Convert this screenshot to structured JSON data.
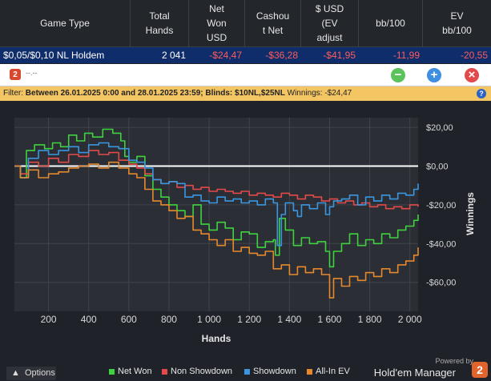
{
  "columns": [
    {
      "label": "Game Type"
    },
    {
      "label": "Total\nHands"
    },
    {
      "label": "Net\nWon\nUSD"
    },
    {
      "label": "Cashou\nt Net"
    },
    {
      "label": "$ USD\n(EV\nadjust"
    },
    {
      "label": "bb/100"
    },
    {
      "label": "EV\nbb/100"
    }
  ],
  "row": {
    "game_type": "$0,05/$0,10 NL Holdem",
    "total_hands": "2 041",
    "net_won": "-$24,47",
    "cashout_net": "-$36,28",
    "ev_adjusted": "-$41,95",
    "bb100": "-11,99",
    "ev_bb100": "-20,55"
  },
  "toolbar": {
    "logo_text": "2",
    "title": "--.--",
    "add_icon": "+",
    "remove_icon": "−",
    "close_icon": "×"
  },
  "filter": {
    "label": "Filter:",
    "text": "Between 26.01.2025 0:00 and 28.01.2025 23:59; Blinds: $10NL,$25NL",
    "winnings_label": "Winnings:",
    "winnings_value": "-$24,47",
    "info_icon": "?"
  },
  "chart_data": {
    "type": "line",
    "xlabel": "Hands",
    "ylabel": "Winnings",
    "xlim": [
      30,
      2041
    ],
    "ylim": [
      -75,
      25
    ],
    "x_ticks": [
      200,
      400,
      600,
      800,
      1000,
      1200,
      1400,
      1600,
      1800,
      2000
    ],
    "x_tick_labels": [
      "200",
      "400",
      "600",
      "800",
      "1 000",
      "1 200",
      "1 400",
      "1 600",
      "1 800",
      "2 000"
    ],
    "y_ticks": [
      20,
      0,
      -20,
      -40,
      -60
    ],
    "y_tick_labels": [
      "$20,00",
      "$0,00",
      "-$20,00",
      "-$40,00",
      "-$60,00"
    ],
    "grid": true,
    "legend_position": "bottom",
    "series": [
      {
        "name": "Net Won",
        "color": "#3fd23f",
        "points": [
          [
            30,
            0
          ],
          [
            60,
            -6
          ],
          [
            90,
            8
          ],
          [
            130,
            11
          ],
          [
            180,
            9
          ],
          [
            220,
            12
          ],
          [
            260,
            10
          ],
          [
            300,
            16
          ],
          [
            340,
            13
          ],
          [
            380,
            17
          ],
          [
            420,
            15
          ],
          [
            470,
            19
          ],
          [
            520,
            17
          ],
          [
            560,
            13
          ],
          [
            580,
            5
          ],
          [
            600,
            2
          ],
          [
            640,
            5
          ],
          [
            680,
            -5
          ],
          [
            720,
            -12
          ],
          [
            760,
            -16
          ],
          [
            800,
            -20
          ],
          [
            840,
            -23
          ],
          [
            880,
            -26
          ],
          [
            920,
            -20
          ],
          [
            960,
            -30
          ],
          [
            1000,
            -33
          ],
          [
            1040,
            -29
          ],
          [
            1080,
            -32
          ],
          [
            1120,
            -38
          ],
          [
            1160,
            -34
          ],
          [
            1200,
            -35
          ],
          [
            1240,
            -42
          ],
          [
            1280,
            -39
          ],
          [
            1320,
            -38
          ],
          [
            1330,
            -46
          ],
          [
            1350,
            -27
          ],
          [
            1380,
            -33
          ],
          [
            1420,
            -41
          ],
          [
            1460,
            -37
          ],
          [
            1500,
            -40
          ],
          [
            1540,
            -39
          ],
          [
            1580,
            -44
          ],
          [
            1600,
            -52
          ],
          [
            1620,
            -44
          ],
          [
            1660,
            -40
          ],
          [
            1700,
            -35
          ],
          [
            1740,
            -41
          ],
          [
            1780,
            -38
          ],
          [
            1820,
            -40
          ],
          [
            1860,
            -35
          ],
          [
            1900,
            -37
          ],
          [
            1940,
            -33
          ],
          [
            1980,
            -31
          ],
          [
            2020,
            -28
          ],
          [
            2041,
            -25
          ]
        ]
      },
      {
        "name": "Non Showdown",
        "color": "#e24a4a",
        "points": [
          [
            30,
            0
          ],
          [
            60,
            -4
          ],
          [
            100,
            2
          ],
          [
            150,
            0
          ],
          [
            200,
            4
          ],
          [
            250,
            2
          ],
          [
            300,
            6
          ],
          [
            350,
            5
          ],
          [
            400,
            8
          ],
          [
            450,
            6
          ],
          [
            500,
            7
          ],
          [
            550,
            3
          ],
          [
            600,
            1
          ],
          [
            640,
            -1
          ],
          [
            680,
            -4
          ],
          [
            720,
            -7
          ],
          [
            760,
            -9
          ],
          [
            800,
            -8
          ],
          [
            840,
            -11
          ],
          [
            880,
            -10
          ],
          [
            920,
            -12
          ],
          [
            960,
            -11
          ],
          [
            1000,
            -13
          ],
          [
            1040,
            -12
          ],
          [
            1080,
            -13
          ],
          [
            1120,
            -14
          ],
          [
            1160,
            -13
          ],
          [
            1200,
            -15
          ],
          [
            1240,
            -14
          ],
          [
            1280,
            -15
          ],
          [
            1320,
            -16
          ],
          [
            1360,
            -14
          ],
          [
            1400,
            -15
          ],
          [
            1440,
            -17
          ],
          [
            1480,
            -15
          ],
          [
            1520,
            -16
          ],
          [
            1560,
            -18
          ],
          [
            1600,
            -17
          ],
          [
            1640,
            -19
          ],
          [
            1680,
            -18
          ],
          [
            1720,
            -20
          ],
          [
            1760,
            -19
          ],
          [
            1800,
            -21
          ],
          [
            1840,
            -20
          ],
          [
            1880,
            -22
          ],
          [
            1920,
            -21
          ],
          [
            1960,
            -22
          ],
          [
            2000,
            -20
          ],
          [
            2041,
            -21
          ]
        ]
      },
      {
        "name": "Showdown",
        "color": "#3a96e0",
        "points": [
          [
            30,
            0
          ],
          [
            60,
            -6
          ],
          [
            100,
            4
          ],
          [
            150,
            8
          ],
          [
            200,
            6
          ],
          [
            250,
            8
          ],
          [
            300,
            10
          ],
          [
            350,
            7
          ],
          [
            400,
            11
          ],
          [
            450,
            12
          ],
          [
            500,
            10
          ],
          [
            550,
            9
          ],
          [
            600,
            3
          ],
          [
            640,
            2
          ],
          [
            680,
            -1
          ],
          [
            720,
            -7
          ],
          [
            760,
            -9
          ],
          [
            800,
            -8
          ],
          [
            840,
            -9
          ],
          [
            880,
            -16
          ],
          [
            920,
            -15
          ],
          [
            960,
            -18
          ],
          [
            1000,
            -19
          ],
          [
            1040,
            -16
          ],
          [
            1080,
            -18
          ],
          [
            1120,
            -17
          ],
          [
            1160,
            -19
          ],
          [
            1200,
            -18
          ],
          [
            1240,
            -20
          ],
          [
            1280,
            -17
          ],
          [
            1320,
            -19
          ],
          [
            1340,
            -41
          ],
          [
            1360,
            -25
          ],
          [
            1380,
            -19
          ],
          [
            1420,
            -23
          ],
          [
            1440,
            -26
          ],
          [
            1460,
            -20
          ],
          [
            1500,
            -22
          ],
          [
            1540,
            -19
          ],
          [
            1580,
            -25
          ],
          [
            1600,
            -21
          ],
          [
            1620,
            -18
          ],
          [
            1660,
            -17
          ],
          [
            1700,
            -15
          ],
          [
            1740,
            -20
          ],
          [
            1780,
            -16
          ],
          [
            1820,
            -18
          ],
          [
            1860,
            -15
          ],
          [
            1900,
            -17
          ],
          [
            1940,
            -14
          ],
          [
            1980,
            -15
          ],
          [
            2020,
            -12
          ],
          [
            2041,
            -9
          ]
        ]
      },
      {
        "name": "All-In EV",
        "color": "#e6892e",
        "points": [
          [
            30,
            0
          ],
          [
            60,
            -6
          ],
          [
            100,
            -2
          ],
          [
            150,
            -6
          ],
          [
            200,
            -4
          ],
          [
            250,
            -3
          ],
          [
            300,
            -1
          ],
          [
            350,
            0
          ],
          [
            400,
            1
          ],
          [
            450,
            -1
          ],
          [
            500,
            2
          ],
          [
            550,
            -1
          ],
          [
            600,
            -4
          ],
          [
            640,
            -6
          ],
          [
            680,
            -12
          ],
          [
            720,
            -18
          ],
          [
            760,
            -20
          ],
          [
            800,
            -23
          ],
          [
            840,
            -27
          ],
          [
            880,
            -26
          ],
          [
            920,
            -33
          ],
          [
            960,
            -35
          ],
          [
            1000,
            -38
          ],
          [
            1040,
            -41
          ],
          [
            1080,
            -38
          ],
          [
            1120,
            -44
          ],
          [
            1160,
            -42
          ],
          [
            1200,
            -45
          ],
          [
            1240,
            -46
          ],
          [
            1280,
            -44
          ],
          [
            1320,
            -53
          ],
          [
            1360,
            -51
          ],
          [
            1400,
            -56
          ],
          [
            1440,
            -52
          ],
          [
            1480,
            -55
          ],
          [
            1520,
            -53
          ],
          [
            1560,
            -56
          ],
          [
            1600,
            -68
          ],
          [
            1620,
            -58
          ],
          [
            1660,
            -62
          ],
          [
            1700,
            -57
          ],
          [
            1740,
            -59
          ],
          [
            1780,
            -55
          ],
          [
            1820,
            -57
          ],
          [
            1860,
            -53
          ],
          [
            1900,
            -55
          ],
          [
            1940,
            -51
          ],
          [
            1980,
            -49
          ],
          [
            2020,
            -46
          ],
          [
            2041,
            -42
          ]
        ]
      }
    ],
    "zero_line": true
  },
  "footer": {
    "options_label": "Options",
    "powered_by": "Powered by",
    "brand": "Hold'em Manager",
    "brand_logo": "2"
  }
}
